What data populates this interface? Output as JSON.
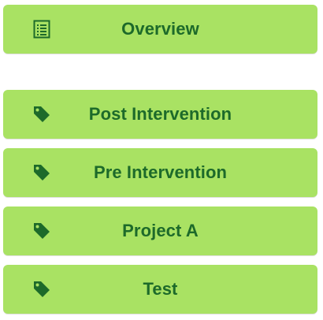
{
  "overview": {
    "label": "Overview",
    "icon": "list-icon"
  },
  "tags": [
    {
      "label": "Post Intervention",
      "icon": "tag-icon"
    },
    {
      "label": "Pre Intervention",
      "icon": "tag-icon"
    },
    {
      "label": "Project A",
      "icon": "tag-icon"
    },
    {
      "label": "Test",
      "icon": "tag-icon"
    }
  ],
  "colors": {
    "button_background": "#a9e263",
    "text": "#1d6a2a"
  }
}
